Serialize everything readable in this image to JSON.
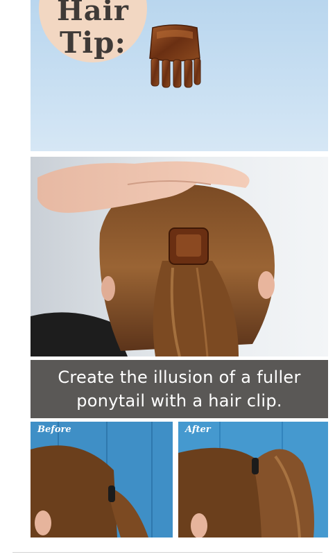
{
  "badge": {
    "line1": "Hair",
    "line2": "Tip:"
  },
  "caption": {
    "text": "Create the illusion of a fuller\nponytail with a hair clip."
  },
  "before": {
    "label": "Before"
  },
  "after": {
    "label": "After"
  },
  "colors": {
    "badge": "#f2d7c2",
    "caption_bg": "#5a5856",
    "wall_blue": "#b9d6ee",
    "wood_blue": "#3f8fc6"
  },
  "icons": [
    "hair-clip-icon"
  ]
}
